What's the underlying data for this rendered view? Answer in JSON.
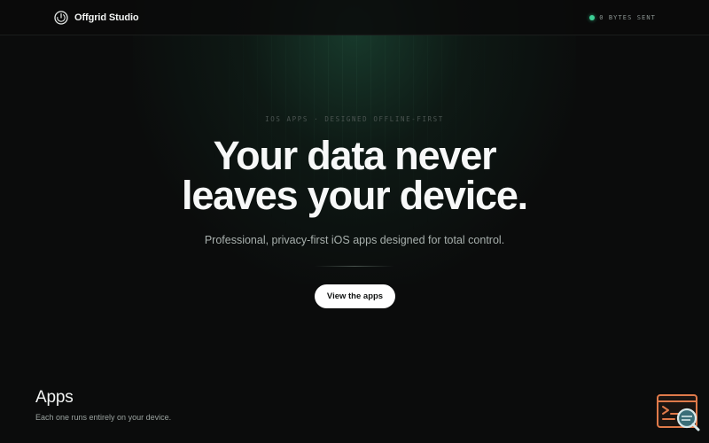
{
  "header": {
    "brand_name": "Offgrid Studio",
    "brand_icon": "power-icon",
    "status_text": "0 BYTES SENT",
    "status_color": "#3ccf95"
  },
  "hero": {
    "eyebrow": "IOS APPS · DESIGNED OFFLINE-FIRST",
    "headline_line1": "Your data never",
    "headline_line2": "leaves your device.",
    "subtitle": "Professional, privacy-first iOS apps designed for total control.",
    "cta_label": "View the apps"
  },
  "apps": {
    "title": "Apps",
    "subtitle": "Each one runs entirely on your device."
  },
  "widget": {
    "icon": "terminal-search-icon",
    "accent_color": "#e07a4a"
  }
}
